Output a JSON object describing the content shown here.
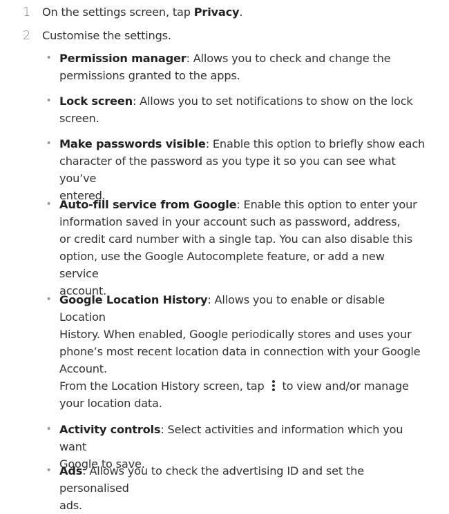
{
  "steps": [
    {
      "number": "1",
      "text_before": "On the settings screen, tap ",
      "bold": "Privacy",
      "text_after": "."
    },
    {
      "number": "2",
      "text_before": "Customise the settings.",
      "bold": "",
      "text_after": ""
    }
  ],
  "bullet_glyph": "•",
  "items": [
    {
      "term": "Permission manager",
      "lines": [
        ": Allows you to check and change the",
        "permissions granted to the apps."
      ]
    },
    {
      "term": "Lock screen",
      "lines": [
        ": Allows you to set notifications to show on the lock",
        "screen."
      ]
    },
    {
      "term": "Make passwords visible",
      "lines": [
        ": Enable this option to briefly show each",
        "character of the password as you type it so you can see what you’ve",
        "entered."
      ]
    },
    {
      "term": "Auto-fill service from Google",
      "lines": [
        ": Enable this option to enter your",
        "information saved in your account such as password, address,",
        "or credit card number with a single tap. You can also disable this",
        "option, use the Google Autocomplete feature, or add a new service",
        "account."
      ]
    },
    {
      "term": "Google Location History",
      "lines": [
        ": Allows you to enable or disable Location",
        "History. When enabled, Google periodically stores and uses your",
        "phone’s most recent location data in connection with your Google",
        "Account."
      ],
      "extra_before": "From the Location History screen, tap ",
      "extra_icon": "more-options-kebab-icon",
      "extra_after": " to view and/or manage",
      "extra_line2": "your location data."
    },
    {
      "term": "Activity controls",
      "lines": [
        ": Select activities and information which you want",
        "Google to save."
      ]
    },
    {
      "term": "Ads",
      "lines": [
        ": Allows you to check the advertising ID and set the personalised",
        "ads."
      ]
    }
  ]
}
